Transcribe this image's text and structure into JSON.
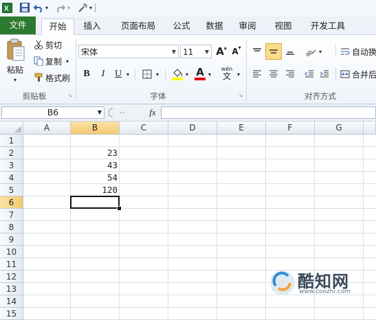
{
  "quick_access": {
    "app_icon": "excel-icon",
    "save_icon": "save-icon",
    "undo_icon": "undo-icon",
    "redo_icon": "redo-icon",
    "customize_icon": "customize-icon"
  },
  "tabs": [
    {
      "label": "文件",
      "name": "tab-file"
    },
    {
      "label": "开始",
      "name": "tab-home"
    },
    {
      "label": "插入",
      "name": "tab-insert"
    },
    {
      "label": "页面布局",
      "name": "tab-page-layout"
    },
    {
      "label": "公式",
      "name": "tab-formulas"
    },
    {
      "label": "数据",
      "name": "tab-data"
    },
    {
      "label": "审阅",
      "name": "tab-review"
    },
    {
      "label": "视图",
      "name": "tab-view"
    },
    {
      "label": "开发工具",
      "name": "tab-developer"
    }
  ],
  "ribbon": {
    "clipboard": {
      "paste": "粘贴",
      "cut": "剪切",
      "copy": "复制",
      "format_painter": "格式刷",
      "group_label": "剪贴板"
    },
    "font": {
      "font_name": "宋体",
      "font_size": "11",
      "bold": "B",
      "italic": "I",
      "underline": "U",
      "font_color_letter": "A",
      "wen": "wén",
      "wen_char": "文",
      "grow": "A",
      "shrink": "A",
      "group_label": "字体"
    },
    "alignment": {
      "wrap_text": "自动换",
      "merge": "合并后",
      "group_label": "对齐方式"
    }
  },
  "formula_bar": {
    "name_box": "B6",
    "fx_label": "fx",
    "formula": ""
  },
  "sheet": {
    "columns": [
      "A",
      "B",
      "C",
      "D",
      "E",
      "F",
      "G"
    ],
    "rows": [
      "1",
      "2",
      "3",
      "4",
      "5",
      "6",
      "7",
      "8",
      "9",
      "10",
      "11",
      "12",
      "13",
      "14",
      "15"
    ],
    "cells": {
      "B2": "23",
      "B3": "43",
      "B4": "54",
      "B5": "120"
    },
    "active_cell": "B6"
  },
  "watermark": {
    "brand": "酷知网",
    "url": "www.coozhi.com"
  },
  "colors": {
    "file_tab": "#2c7a2f",
    "selected_header": "#f3c970",
    "highlight_yellow": "#ffff00",
    "font_red": "#e00000"
  }
}
